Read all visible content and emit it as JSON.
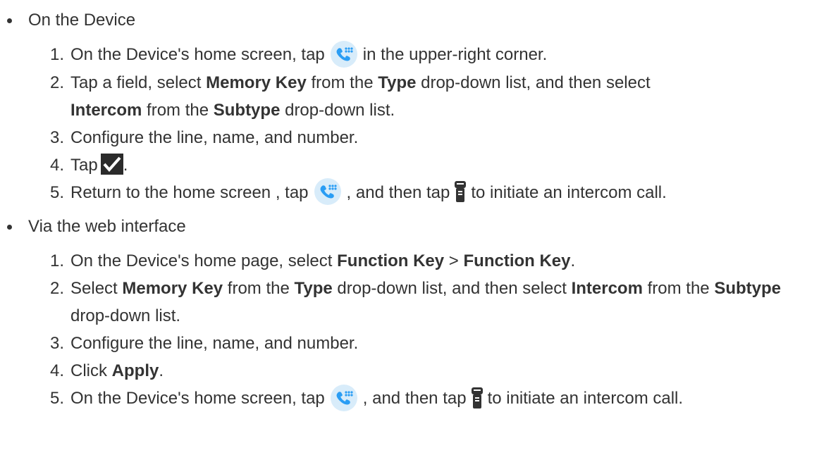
{
  "sections": [
    {
      "title": "On the Device",
      "steps": [
        {
          "num": "1.",
          "a": "On the Device's home screen, tap",
          "icon1": "phone-dialpad-icon",
          "b": "in the upper-right corner."
        },
        {
          "num": "2.",
          "a": "Tap a field, select ",
          "b1": "Memory Key",
          "c": " from the ",
          "b2": "Type",
          "d": " drop-down list, and then select ",
          "b3": "Intercom",
          "e": " from the ",
          "b4": "Subtype",
          "f": " drop-down list."
        },
        {
          "num": "3.",
          "a": "Configure the line, name, and number."
        },
        {
          "num": "4.",
          "a": "Tap",
          "icon1": "checkmark-icon",
          "b": "."
        },
        {
          "num": "5.",
          "a": "Return to the home screen , tap",
          "icon1": "phone-dialpad-icon",
          "b": ", and then tap",
          "icon2": "intercom-walkie-icon",
          "c": "to initiate an intercom call."
        }
      ]
    },
    {
      "title": "Via the web interface",
      "steps": [
        {
          "num": "1.",
          "a": "On the Device's home page, select ",
          "b1": "Function Key",
          "c": " > ",
          "b2": "Function Key",
          "d": "."
        },
        {
          "num": "2.",
          "a": "Select ",
          "b1": "Memory Key",
          "c": " from the ",
          "b2": "Type",
          "d": " drop-down list, and then select ",
          "b3": "Intercom",
          "e": " from the ",
          "b4": "Subtype",
          "f": " drop-down list."
        },
        {
          "num": "3.",
          "a": "Configure the line, name, and number."
        },
        {
          "num": "4.",
          "a": "Click ",
          "b1": "Apply",
          "c": "."
        },
        {
          "num": "5.",
          "a": "On the Device's home screen, tap",
          "icon1": "phone-dialpad-icon",
          "b": ", and then tap",
          "icon2": "intercom-walkie-icon",
          "c": "to initiate an intercom call."
        }
      ]
    }
  ],
  "colors": {
    "text": "#333333",
    "phone_icon_bg": "#d8ecfa",
    "phone_icon_fg": "#2a9df4",
    "check_bg": "#2b2b2b"
  }
}
